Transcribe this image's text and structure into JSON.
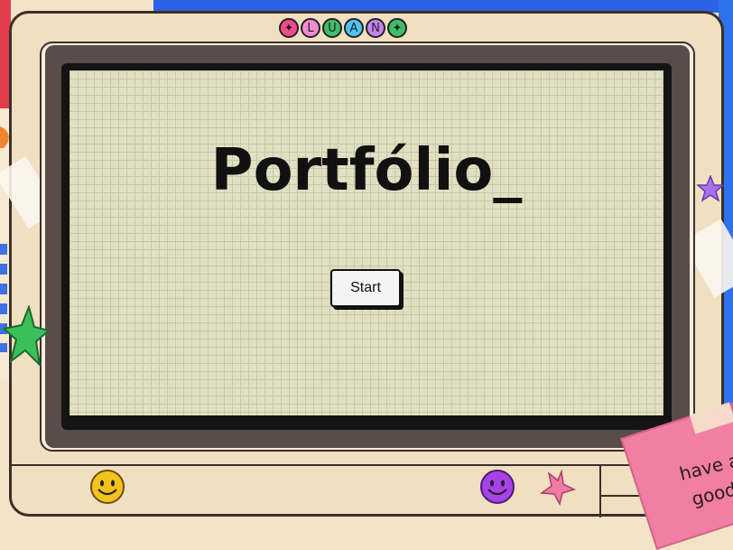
{
  "screen": {
    "title": "Portfólio_",
    "start_label": "Start"
  },
  "logo": {
    "letters": [
      "✦",
      "L",
      "U",
      "A",
      "N",
      "✦"
    ],
    "colors": [
      "#f04a8a",
      "#f28bd0",
      "#3fbd6a",
      "#4fc3f2",
      "#c583f0",
      "#3fbd6a"
    ]
  },
  "note": {
    "line1": "have a",
    "line2": "good"
  },
  "colors": {
    "screen_bg": "#e1e0c2",
    "monitor_body": "#f0dfc1",
    "star_green": "#3bbf58",
    "star_purple": "#a96ff0",
    "star_pink": "#f07aa4",
    "smiley_yellow": "#f4c21c",
    "smiley_purple": "#a642e8",
    "note_pink": "#f17fa3"
  }
}
